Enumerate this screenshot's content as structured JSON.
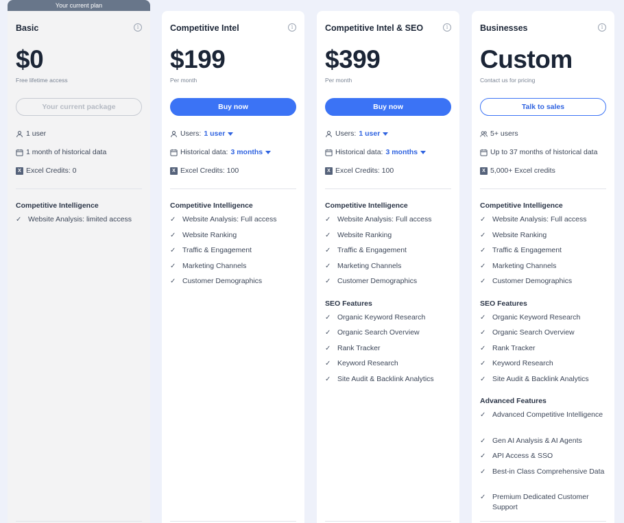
{
  "plans": [
    {
      "ribbon": "Your current plan",
      "name": "Basic",
      "price": "$0",
      "price_sub": "Free lifetime access",
      "button": "Your current package",
      "users": "1 user",
      "history": "1 month of historical data",
      "excel": "Excel Credits: 0",
      "sections": [
        {
          "title": "Competitive Intelligence",
          "items": [
            "Website Analysis: limited access"
          ]
        }
      ]
    },
    {
      "name": "Competitive Intel",
      "price": "$199",
      "price_sub": "Per month",
      "button": "Buy now",
      "users_label": "Users:",
      "users_value": "1 user",
      "history_label": "Historical data:",
      "history_value": "3 months",
      "excel": "Excel Credits: 100",
      "sections": [
        {
          "title": "Competitive Intelligence",
          "items": [
            "Website Analysis: Full access",
            "Website Ranking",
            "Traffic & Engagement",
            "Marketing Channels",
            "Customer Demographics"
          ]
        }
      ]
    },
    {
      "name": "Competitive Intel & SEO",
      "price": "$399",
      "price_sub": "Per month",
      "button": "Buy now",
      "users_label": "Users:",
      "users_value": "1 user",
      "history_label": "Historical data:",
      "history_value": "3 months",
      "excel": "Excel Credits: 100",
      "sections": [
        {
          "title": "Competitive Intelligence",
          "items": [
            "Website Analysis: Full access",
            "Website Ranking",
            "Traffic & Engagement",
            "Marketing Channels",
            "Customer Demographics"
          ]
        },
        {
          "title": "SEO Features",
          "items": [
            "Organic Keyword Research",
            "Organic Search Overview",
            "Rank Tracker",
            "Keyword Research",
            "Site Audit & Backlink Analytics"
          ]
        }
      ]
    },
    {
      "name": "Businesses",
      "price": "Custom",
      "price_sub": "Contact us for pricing",
      "button": "Talk to sales",
      "users": "5+ users",
      "history": "Up to 37 months of historical data",
      "excel": "5,000+ Excel credits",
      "sections": [
        {
          "title": "Competitive Intelligence",
          "items": [
            "Website Analysis: Full access",
            "Website Ranking",
            "Traffic & Engagement",
            "Marketing Channels",
            "Customer Demographics"
          ]
        },
        {
          "title": "SEO Features",
          "items": [
            "Organic Keyword Research",
            "Organic Search Overview",
            "Rank Tracker",
            "Keyword Research",
            "Site Audit & Backlink Analytics"
          ]
        },
        {
          "title": "Advanced Features",
          "items": [
            "Advanced Competitive Intelligence",
            "Gen AI Analysis & AI Agents",
            "API Access & SSO",
            "Best-in Class Comprehensive Data",
            "Premium Dedicated Customer Support"
          ]
        }
      ]
    }
  ],
  "icons": {
    "info": "info-icon",
    "user": "user-icon",
    "users": "users-icon",
    "calendar": "calendar-icon",
    "excel": "excel-icon",
    "check": "check-icon",
    "caret": "caret-down-icon"
  },
  "colors": {
    "accent": "#3b73f5",
    "ribbon": "#68768a",
    "page_bg": "#eef1fa"
  }
}
